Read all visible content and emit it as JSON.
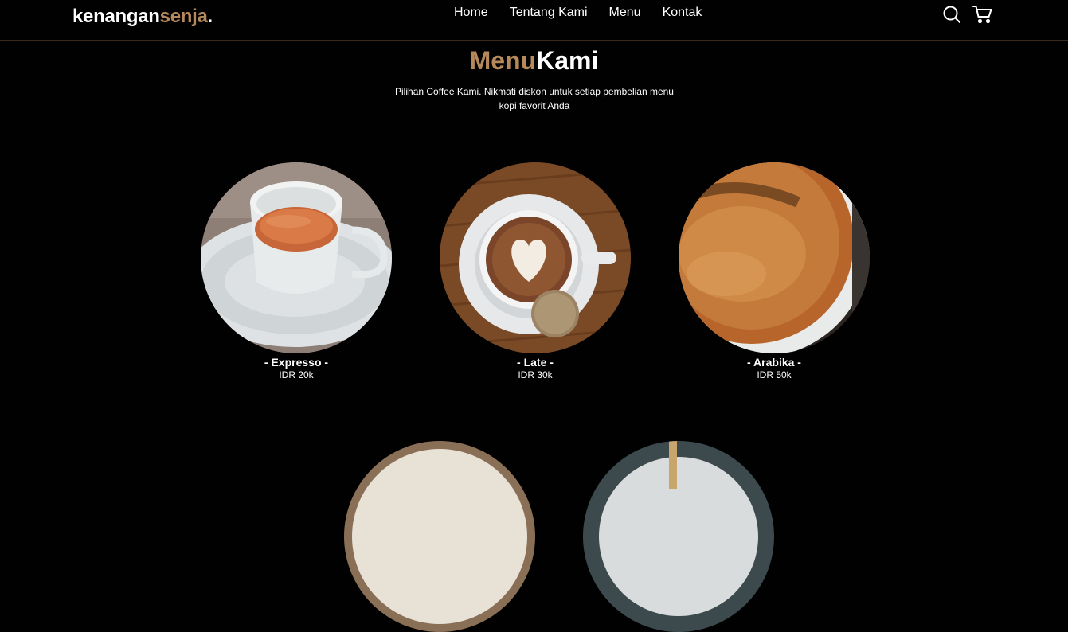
{
  "brand": {
    "name_main": "kenangan",
    "name_accent": "senja",
    "dot": "."
  },
  "nav": {
    "items": [
      "Home",
      "Tentang Kami",
      "Menu",
      "Kontak"
    ]
  },
  "icons": {
    "search": "search-icon",
    "cart": "shopping-cart-icon"
  },
  "menu": {
    "title_accent": "Menu",
    "title_main": "Kami",
    "description": "Pilihan Coffee Kami. Nikmati diskon untuk setiap pembelian menu kopi favorit Anda",
    "items": [
      {
        "name": "- Expresso -",
        "price": "IDR 20k"
      },
      {
        "name": "- Late -",
        "price": "IDR 30k"
      },
      {
        "name": "- Arabika -",
        "price": "IDR 50k"
      }
    ]
  },
  "colors": {
    "accent": "#b6895b",
    "background": "#010101"
  }
}
